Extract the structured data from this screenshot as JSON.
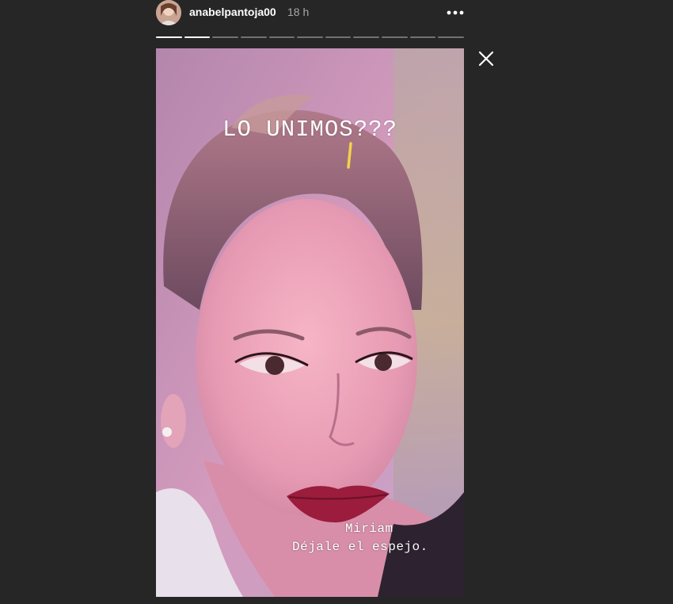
{
  "header": {
    "username": "anabelpantoja00",
    "timestamp": "18 h",
    "more_icon": "more-horizontal-icon"
  },
  "progress": {
    "segments": [
      1,
      1,
      0,
      0,
      0,
      0,
      0,
      0,
      0,
      0,
      0
    ],
    "active_index": 1
  },
  "close_icon": "close-icon",
  "story": {
    "text": "LO UNIMOS???",
    "subtitle_name": "Miriam",
    "subtitle_line": "Déjale el espejo."
  },
  "colors": {
    "background": "#262626",
    "text_primary": "#ffffff",
    "text_secondary": "#a8a8a8",
    "lip": "#9b1c3c"
  }
}
